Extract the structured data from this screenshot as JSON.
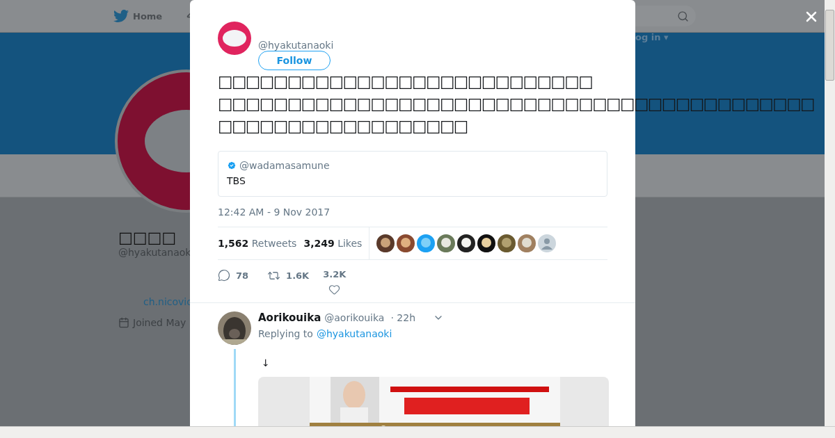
{
  "top_nav": {
    "home": "Home",
    "login": "og in ▾"
  },
  "profile": {
    "name": "□□□□",
    "handle": "@hyakutanaok",
    "link": "ch.nicovic",
    "joined": "Joined May"
  },
  "tweet": {
    "handle": "@hyakutanaoki",
    "follow": "Follow",
    "text_lines": [
      "□□□□□□□□□□□□□□□□□□□□□□□□□□□",
      "□□□□□□□□□□□□□□□□□□□□□□□□□□□□□□□□□□□□□□□□□□□",
      "□□□□□□□□□□□□□□□□□□"
    ],
    "quote": {
      "handle": "@wadamasamune",
      "verified": true,
      "text": "TBS"
    },
    "timestamp": "12:42 AM - 9 Nov 2017",
    "retweets": {
      "count": "1,562",
      "label": "Retweets"
    },
    "likes": {
      "count": "3,249",
      "label": "Likes"
    },
    "liker_avatars": [
      {
        "kind": "picture"
      },
      {
        "kind": "picture"
      },
      {
        "kind": "picture"
      },
      {
        "kind": "picture"
      },
      {
        "kind": "picture"
      },
      {
        "kind": "picture"
      },
      {
        "kind": "picture"
      },
      {
        "kind": "picture"
      },
      {
        "kind": "default"
      }
    ],
    "actions": [
      {
        "kind": "reply",
        "count": "78"
      },
      {
        "kind": "retweet",
        "count": "1.6K"
      },
      {
        "kind": "like",
        "count": "3.2K"
      }
    ]
  },
  "reply": {
    "name": "Aorikouika",
    "handle": "@aorikouika",
    "time": "· 22h",
    "replying_to": "Replying to",
    "replying_handle": "@hyakutanaoki",
    "text": "↓"
  }
}
